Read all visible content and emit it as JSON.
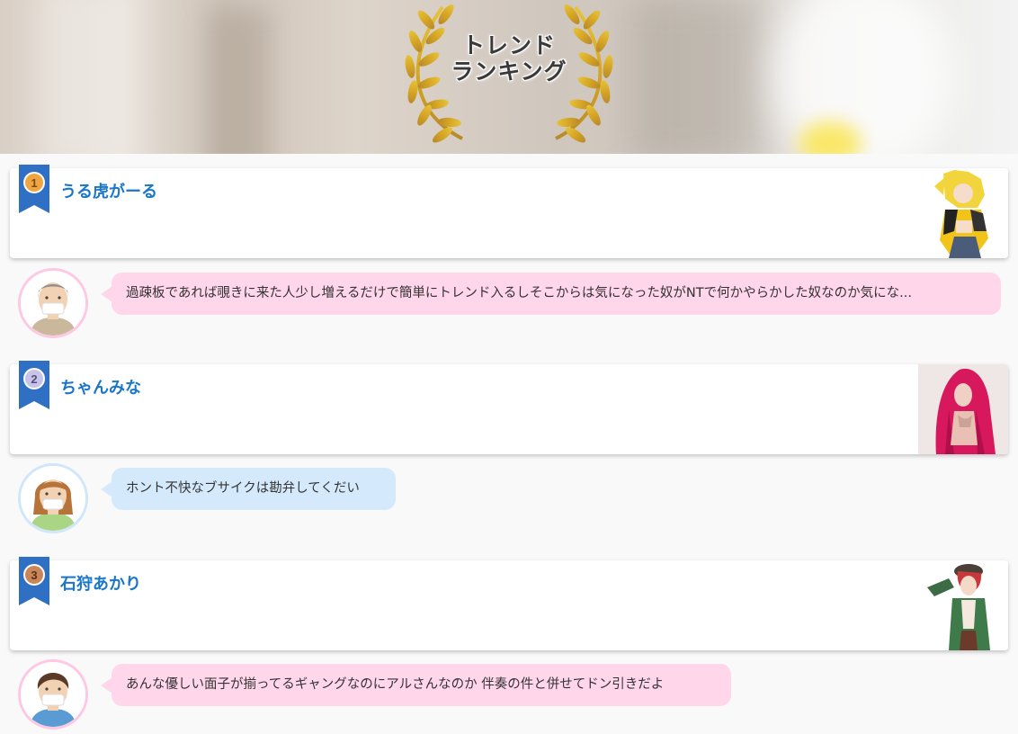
{
  "header": {
    "title": "トレンド\nランキング"
  },
  "rankings": [
    {
      "rank": "1",
      "name": "うる虎がーる",
      "comment": "過疎板であれば覗きに来た人少し増えるだけで簡単にトレンド入るしそこからは気になった奴がNTで何かやらかした奴なのか気にな...",
      "bubble_color": "#ffd6ea"
    },
    {
      "rank": "2",
      "name": "ちゃんみな",
      "comment": "ホント不快なブサイクは勘弁してくだい",
      "bubble_color": "#d4eafc"
    },
    {
      "rank": "3",
      "name": "石狩あかり",
      "comment": "あんな優しい面子が揃ってるギャングなのにアルさんなのか 伴奏の件と併せてドン引きだよ",
      "bubble_color": "#ffd6ea"
    }
  ],
  "colors": {
    "name_text": "#1976c8",
    "ribbon": "#2f6fc4",
    "medal_gold": "#f0a640",
    "medal_silver": "#c8c3e8",
    "medal_bronze": "#c9865a",
    "bubble_pink": "#ffd6ea",
    "bubble_blue": "#d4eafc"
  },
  "icons": {
    "wreath": "laurel-wreath-icon",
    "ribbon": "rank-ribbon-icon",
    "avatar": "user-avatar-icon"
  }
}
